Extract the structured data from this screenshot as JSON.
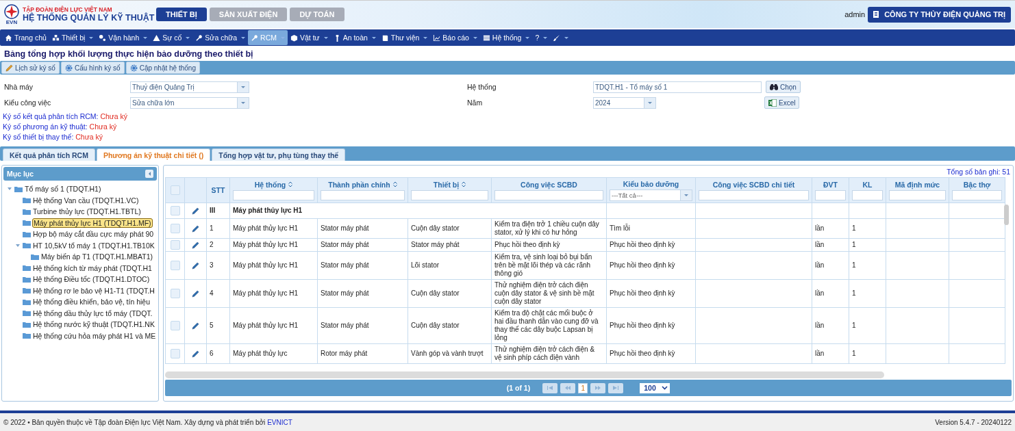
{
  "header": {
    "logo_text": "EVN",
    "org": "TẬP ĐOÀN ĐIỆN LỰC VIỆT NAM",
    "system": "HỆ THỐNG QUẢN LÝ KỸ THUẬT",
    "modules": [
      {
        "label": "THIẾT BỊ",
        "selected": true
      },
      {
        "label": "SẢN XUẤT ĐIỆN",
        "selected": false
      },
      {
        "label": "DỰ TOÁN",
        "selected": false
      }
    ],
    "user": "admin",
    "company": "CÔNG TY THỦY ĐIỆN QUẢNG TRỊ"
  },
  "menu": [
    {
      "label": "Trang chủ",
      "dropdown": false,
      "selected": false
    },
    {
      "label": "Thiết bị",
      "dropdown": true,
      "selected": false
    },
    {
      "label": "Vận hành",
      "dropdown": true,
      "selected": false
    },
    {
      "label": "Sự cố",
      "dropdown": true,
      "selected": false
    },
    {
      "label": "Sửa chữa",
      "dropdown": true,
      "selected": false
    },
    {
      "label": "RCM",
      "dropdown": true,
      "selected": true
    },
    {
      "label": "Vật tư",
      "dropdown": true,
      "selected": false
    },
    {
      "label": "An toàn",
      "dropdown": true,
      "selected": false
    },
    {
      "label": "Thư viện",
      "dropdown": true,
      "selected": false
    },
    {
      "label": "Báo cáo",
      "dropdown": true,
      "selected": false
    },
    {
      "label": "Hệ thống",
      "dropdown": true,
      "selected": false
    },
    {
      "label": "?",
      "dropdown": true,
      "selected": false
    }
  ],
  "page_title": "Bảng tổng hợp khối lượng thực hiện bảo dưỡng theo thiết bị",
  "toolbar": [
    {
      "label": "Lịch sử ký số",
      "kind": "pencil"
    },
    {
      "label": "Cấu hình ký số",
      "kind": "gear"
    },
    {
      "label": "Cập nhật hệ thống",
      "kind": "gear"
    }
  ],
  "form": {
    "left": [
      {
        "label": "Nhà máy",
        "kind": "select",
        "value": "Thuỷ điện Quảng Trị"
      },
      {
        "label": "Kiểu công việc",
        "kind": "select",
        "value": "Sửa chữa lớn"
      }
    ],
    "right": [
      {
        "label": "Hệ thống",
        "kind": "input",
        "value": "TDQT.H1 - Tổ máy số 1",
        "button": {
          "label": "Chọn",
          "kind": "binoculars"
        }
      },
      {
        "label": "Năm",
        "kind": "select",
        "value": "2024",
        "button": {
          "label": "Excel",
          "kind": "excel"
        }
      }
    ]
  },
  "signatures": [
    {
      "label": "Ký số kết quả phân tích RCM:",
      "status": "Chưa ký"
    },
    {
      "label": "Ký số phương án kỹ thuật:",
      "status": "Chưa ký"
    },
    {
      "label": "Ký số thiết bị thay thế:",
      "status": "Chưa ký"
    }
  ],
  "tabs": [
    {
      "label": "Kết quả phân tích RCM",
      "selected": false
    },
    {
      "label": "Phương án kỹ thuật chi tiết ()",
      "selected": true
    },
    {
      "label": "Tổng hợp vật tư, phụ tùng thay thế",
      "selected": false
    }
  ],
  "sidebar": {
    "title": "Mục lục",
    "tree": [
      {
        "label": "Tổ máy số 1 (TDQT.H1)",
        "expanded": true,
        "selected": false,
        "children": [
          {
            "label": "Hệ thống Van cầu (TDQT.H1.VC)",
            "selected": false
          },
          {
            "label": "Turbine thủy lực (TDQT.H1.TBTL)",
            "selected": false
          },
          {
            "label": "Máy phát thủy lực H1 (TDQT.H1.MF)",
            "selected": true
          },
          {
            "label": "Hợp bộ máy cắt đầu cực máy phát 90",
            "selected": false
          },
          {
            "label": "HT 10,5kV tổ máy 1 (TDQT.H1.TB10K",
            "expanded": true,
            "selected": false,
            "children": [
              {
                "label": "Máy biến áp T1 (TDQT.H1.MBAT1)",
                "selected": false
              }
            ]
          },
          {
            "label": "Hệ thống kích từ máy phát (TDQT.H1",
            "selected": false
          },
          {
            "label": "Hệ thống Điều tốc (TDQT.H1.DTOC)",
            "selected": false
          },
          {
            "label": "Hệ thống rơ le bảo vệ H1-T1 (TDQT.H",
            "selected": false
          },
          {
            "label": "Hệ thống điều khiển, bảo vệ, tín hiệu",
            "selected": false
          },
          {
            "label": "Hệ thống dầu thủy lực tổ máy (TDQT.",
            "selected": false
          },
          {
            "label": "Hệ thống nước kỹ thuật (TDQT.H1.NK",
            "selected": false
          },
          {
            "label": "Hệ thống cứu hỏa máy phát H1 và ME",
            "selected": false
          }
        ]
      }
    ]
  },
  "table": {
    "total": "Tổng số bản ghi: 51",
    "all_checked": false,
    "columns": [
      {
        "label": "STT",
        "sortable": false
      },
      {
        "label": "Hệ thống",
        "sortable": true,
        "filter": {
          "kind": "text"
        }
      },
      {
        "label": "Thành phần chính",
        "sortable": true,
        "filter": {
          "kind": "text"
        }
      },
      {
        "label": "Thiết bị",
        "sortable": true,
        "filter": {
          "kind": "text"
        }
      },
      {
        "label": "Công việc SCBD",
        "sortable": false,
        "filter": {
          "kind": "text"
        }
      },
      {
        "label": "Kiểu bảo dưỡng",
        "sortable": false,
        "filter": {
          "kind": "select",
          "value": "---Tất cả---"
        }
      },
      {
        "label": "Công việc SCBD chi tiết",
        "sortable": false,
        "filter": {
          "kind": "text"
        }
      },
      {
        "label": "ĐVT",
        "sortable": false,
        "filter": {
          "kind": "text"
        }
      },
      {
        "label": "KL",
        "sortable": false,
        "filter": {
          "kind": "text"
        }
      },
      {
        "label": "Mã định mức",
        "sortable": false,
        "filter": {
          "kind": "text"
        }
      },
      {
        "label": "Bậc thợ",
        "sortable": false,
        "filter": {
          "kind": "text"
        }
      }
    ],
    "group": {
      "stt": "III",
      "label": "Máy phát thủy lực H1",
      "checked": false
    },
    "rows": [
      {
        "checked": false,
        "cells": [
          "1",
          "Máy phát thủy lực H1",
          "Stator máy phát",
          "Cuộn dây stator",
          "Kiểm tra điện trở 1 chiều cuộn dây stator, xử lý khi có hư hỏng",
          "Tìm lỗi",
          null,
          "lần",
          "1",
          null,
          null
        ]
      },
      {
        "checked": false,
        "cells": [
          "2",
          "Máy phát thủy lực H1",
          "Stator máy phát",
          "Stator máy phát",
          "Phục hồi theo định kỳ",
          "Phục hồi theo định kỳ",
          null,
          "lần",
          "1",
          null,
          null
        ]
      },
      {
        "checked": false,
        "cells": [
          "3",
          "Máy phát thủy lực H1",
          "Stator máy phát",
          "Lõi stator",
          "Kiểm tra, vệ sinh loại bỏ bụi bẩn trên bề mặt lõi thép và các rãnh thông gió",
          "Phục hồi theo định kỳ",
          null,
          "lần",
          "1",
          null,
          null
        ]
      },
      {
        "checked": false,
        "cells": [
          "4",
          "Máy phát thủy lực H1",
          "Stator máy phát",
          "Cuộn dây stator",
          "Thử nghiệm điện trở cách điện cuộn dây stator & vệ sinh bề mặt cuộn dây stator",
          "Phục hồi theo định kỳ",
          null,
          "lần",
          "1",
          null,
          null
        ]
      },
      {
        "checked": false,
        "cells": [
          "5",
          "Máy phát thủy lực H1",
          "Stator máy phát",
          "Cuộn dây stator",
          "Kiểm tra độ chặt các mối buộc ở hai đầu thanh dẫn vào cung đỡ và thay thế các dây buộc Lapsan bị lỏng",
          "Phục hồi theo định kỳ",
          null,
          "lần",
          "1",
          null,
          null
        ]
      },
      {
        "checked": false,
        "cells": [
          "6",
          "Máy phát thủy lực",
          "Rotor máy phát",
          "Vành góp và vành trượt",
          "Thử nghiệm điện trở cách điện & vệ sinh phíp cách điện vành",
          "Phục hồi theo định kỳ",
          null,
          "lần",
          "1",
          null,
          null
        ]
      }
    ]
  },
  "pager": {
    "summary": "(1 of 1)",
    "pages": [
      {
        "label": "1",
        "selected": true
      }
    ],
    "page_size": "100"
  },
  "footer": {
    "copyright": "© 2022 • Bản quyền thuộc về Tập đoàn Điện lực Việt Nam. Xây dựng và phát triển bởi",
    "link": "EVNICT",
    "version": "Version 5.4.7 - 20240122"
  }
}
